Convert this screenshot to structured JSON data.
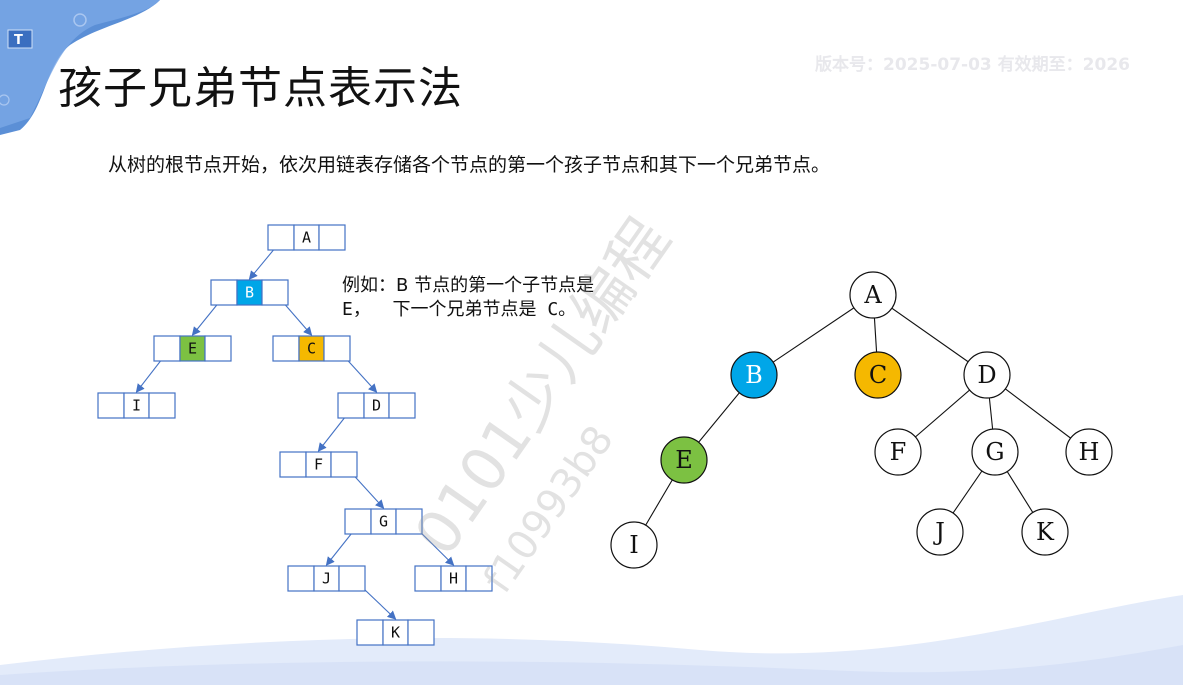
{
  "title": "孩子兄弟节点表示法",
  "version_watermark": "版本号：2025-07-03 有效期至：2026",
  "description": "从树的根节点开始，依次用链表存储各个节点的第一个孩子节点和其下一个兄弟节点。",
  "example": {
    "line1": "例如：B 节点的第一个子节点是",
    "line2": "E，  下一个兄弟节点是 C。"
  },
  "watermark": {
    "line1": "0101少儿编程",
    "line2": "f10993b8"
  },
  "colors": {
    "blue": "#00a6e8",
    "green": "#7cc142",
    "orange": "#f5b800",
    "box_border": "#4472c4",
    "arrow": "#4472c4"
  },
  "linked_list_nodes": [
    {
      "id": "A",
      "color": "none"
    },
    {
      "id": "B",
      "color": "blue"
    },
    {
      "id": "E",
      "color": "green"
    },
    {
      "id": "C",
      "color": "orange"
    },
    {
      "id": "I",
      "color": "none"
    },
    {
      "id": "D",
      "color": "none"
    },
    {
      "id": "F",
      "color": "none"
    },
    {
      "id": "G",
      "color": "none"
    },
    {
      "id": "J",
      "color": "none"
    },
    {
      "id": "H",
      "color": "none"
    },
    {
      "id": "K",
      "color": "none"
    }
  ],
  "linked_list_edges": [
    {
      "from": "A",
      "to": "B",
      "kind": "child"
    },
    {
      "from": "B",
      "to": "E",
      "kind": "child"
    },
    {
      "from": "B",
      "to": "C",
      "kind": "sibling"
    },
    {
      "from": "E",
      "to": "I",
      "kind": "child"
    },
    {
      "from": "C",
      "to": "D",
      "kind": "sibling"
    },
    {
      "from": "D",
      "to": "F",
      "kind": "child"
    },
    {
      "from": "F",
      "to": "G",
      "kind": "sibling"
    },
    {
      "from": "G",
      "to": "J",
      "kind": "child"
    },
    {
      "from": "G",
      "to": "H",
      "kind": "sibling"
    },
    {
      "from": "J",
      "to": "K",
      "kind": "sibling"
    }
  ],
  "tree_nodes": [
    {
      "id": "A",
      "color": "none"
    },
    {
      "id": "B",
      "color": "blue"
    },
    {
      "id": "C",
      "color": "orange"
    },
    {
      "id": "D",
      "color": "none"
    },
    {
      "id": "E",
      "color": "green"
    },
    {
      "id": "F",
      "color": "none"
    },
    {
      "id": "G",
      "color": "none"
    },
    {
      "id": "H",
      "color": "none"
    },
    {
      "id": "I",
      "color": "none"
    },
    {
      "id": "J",
      "color": "none"
    },
    {
      "id": "K",
      "color": "none"
    }
  ],
  "tree_edges": [
    [
      "A",
      "B"
    ],
    [
      "A",
      "C"
    ],
    [
      "A",
      "D"
    ],
    [
      "B",
      "E"
    ],
    [
      "E",
      "I"
    ],
    [
      "D",
      "F"
    ],
    [
      "D",
      "G"
    ],
    [
      "D",
      "H"
    ],
    [
      "G",
      "J"
    ],
    [
      "G",
      "K"
    ]
  ]
}
